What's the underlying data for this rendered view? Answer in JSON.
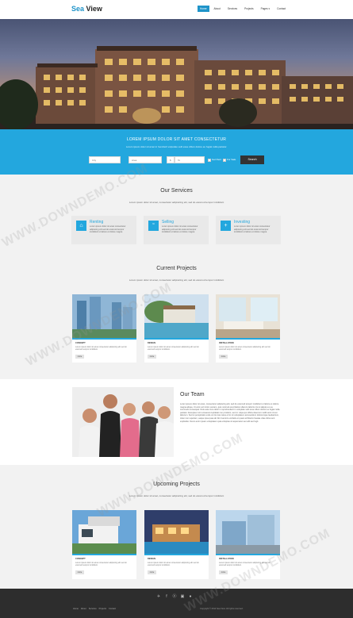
{
  "nav": {
    "logo_part1": "Sea",
    "logo_part2": "View",
    "items": [
      "Home",
      "About",
      "Services",
      "Projects",
      "Pages ▾",
      "Contact"
    ]
  },
  "search": {
    "title": "LOREM IPSUM DOLOR SIT AMET CONSECTETUR",
    "subtitle": "Lorem ipsum dolor sit amet in hendrerit vulputate velit esse cillum dolore eu fugiat nulla pariatur.",
    "fields": [
      "City",
      "Area",
      "$",
      "To"
    ],
    "check1": "Get Rent",
    "check2": "For Sale",
    "button": "Search"
  },
  "services": {
    "title": "Our Services",
    "subtitle": "Lorem ipsum dolor sit amet, consectetur adipisicing elit, sed do eiusmod tempor incididunt",
    "items": [
      {
        "icon": "home-icon",
        "glyph": "⌂",
        "title": "Renting",
        "text": "Lorem ipsum dolor sit amet consectetur adipiscing elit sed do eiusmod tempor incididunt ut labore et dolore magna."
      },
      {
        "icon": "quote-icon",
        "glyph": "“",
        "title": "Selling",
        "text": "Lorem ipsum dolor sit amet consectetur adipiscing elit sed do eiusmod tempor incididunt ut labore et dolore magna."
      },
      {
        "icon": "plus-icon",
        "glyph": "+",
        "title": "Investing",
        "text": "Lorem ipsum dolor sit amet consectetur adipiscing elit sed do eiusmod tempor incididunt ut labore et dolore magna."
      }
    ]
  },
  "current": {
    "title": "Current Projects",
    "subtitle": "Lorem ipsum dolor sit amet, consectetur adipisicing elit, sed do eiusmod tempor incididunt",
    "cards": [
      {
        "label": "CONCEPT",
        "text": "Lorem ipsum dolor sit amet consectetur adipiscing elit sed do eiusmod tempor incididunt.",
        "button": "more"
      },
      {
        "label": "DESIGN",
        "text": "Lorem ipsum dolor sit amet consectetur adipiscing elit sed do eiusmod tempor incididunt.",
        "button": "more"
      },
      {
        "label": "INSTALLATION",
        "text": "Lorem ipsum dolor sit amet consectetur adipiscing elit sed do eiusmod tempor incididunt.",
        "button": "more"
      }
    ]
  },
  "team": {
    "title": "Our Team",
    "text": "Lorem ipsum dolor sit amet, consectetur adipiscing elit, sed do eiusmod tempor incididunt ut labore et dolore magna aliqua. Ut enim ad minim veniam, quis nostrud exercitation ullamco laboris nisi ut aliquip ex ea commodo consequat. Duis aute irure dolor in reprehenderit in voluptate velit esse cillum dolore eu fugiat nulla pariatur. Excepteur sint occaecat cupidatat non proident, sunt in culpa qui officia deserunt mollit anim id est laborum. Sed ut perspiciatis unde omnis iste natus error sit voluptatem accusantium doloremque laudantium, totam rem aperiam, eaque ipsa quae ab illo inventore veritatis et quasi architecto beatae vitae dicta sunt explicabo. Nemo enim ipsam voluptatem quia voluptas sit aspernatur aut odit aut fugit."
  },
  "upcoming": {
    "title": "Upcoming Projects",
    "subtitle": "Lorem ipsum dolor sit amet, consectetur adipisicing elit, sed do eiusmod tempor incididunt",
    "cards": [
      {
        "label": "CONCEPT",
        "text": "Lorem ipsum dolor sit amet consectetur adipiscing elit sed do eiusmod tempor incididunt.",
        "button": "more"
      },
      {
        "label": "DESIGN",
        "text": "Lorem ipsum dolor sit amet consectetur adipiscing elit sed do eiusmod tempor incididunt.",
        "button": "more"
      },
      {
        "label": "INSTALLATION",
        "text": "Lorem ipsum dolor sit amet consectetur adipiscing elit sed do eiusmod tempor incididunt.",
        "button": "more"
      }
    ]
  },
  "footer": {
    "social": [
      {
        "icon": "twitter-icon",
        "glyph": "✈"
      },
      {
        "icon": "facebook-icon",
        "glyph": "f"
      },
      {
        "icon": "pinterest-icon",
        "glyph": "ⓟ"
      },
      {
        "icon": "linkedin-icon",
        "glyph": "▣"
      },
      {
        "icon": "github-icon",
        "glyph": "●"
      }
    ],
    "links": [
      "Home",
      "About",
      "Services",
      "Projects",
      "Contact"
    ],
    "copyright": "Copyright © 2014 Sea View. All rights reserved."
  },
  "watermark": "WWW.DOWNDEMO.COM",
  "colors": {
    "accent": "#23a7de",
    "footer": "#2d2d2d"
  }
}
